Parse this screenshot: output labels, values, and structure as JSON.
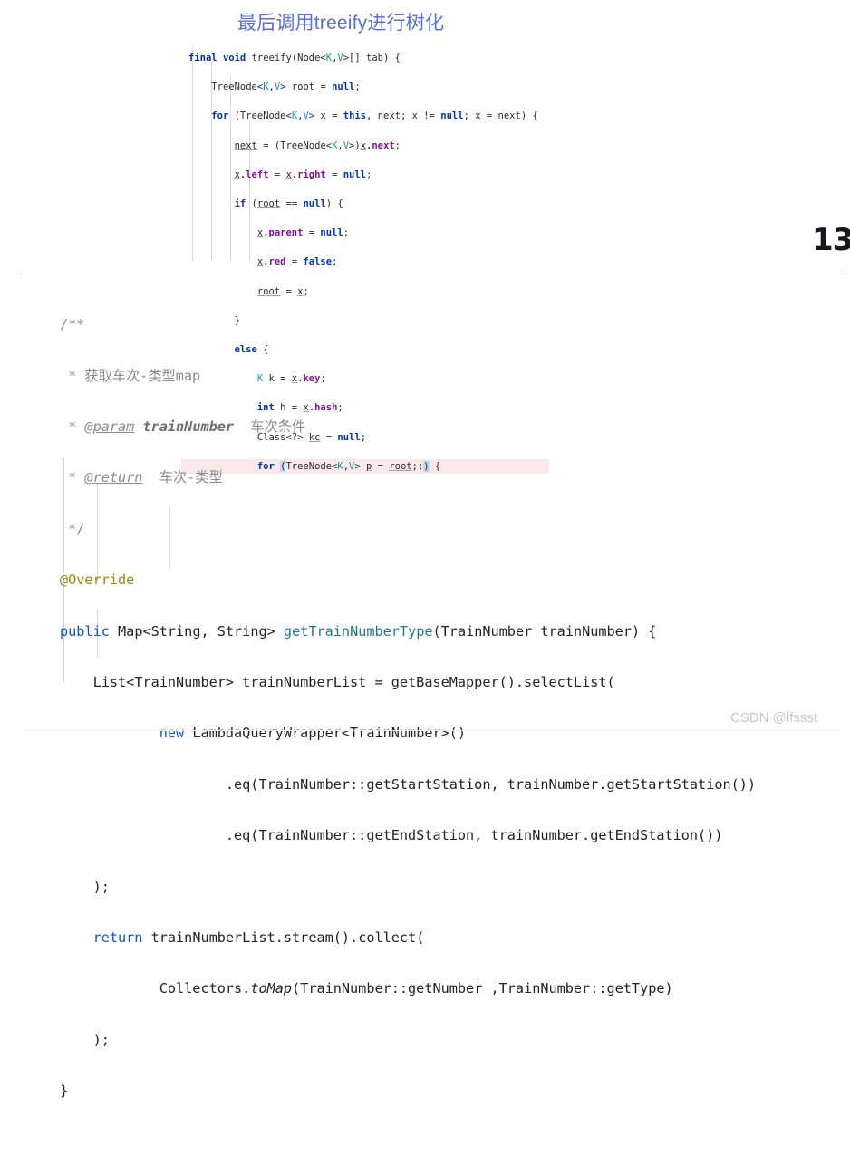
{
  "top": {
    "title": "最后调用treeify进行树化",
    "code_lines": [
      "final void treeify(Node<K,V>[] tab) {",
      "    TreeNode<K,V> root = null;",
      "    for (TreeNode<K,V> x = this, next; x != null; x = next) {",
      "        next = (TreeNode<K,V>)x.next;",
      "        x.left = x.right = null;",
      "        if (root == null) {",
      "            x.parent = null;",
      "            x.red = false;",
      "            root = x;",
      "        }",
      "        else {",
      "            K k = x.key;",
      "            int h = x.hash;",
      "            Class<?> kc = null;",
      "            for (TreeNode<K,V> p = root;;) {"
    ],
    "highlighted_line_index": 14
  },
  "watermark": {
    "text": "13"
  },
  "bottom": {
    "code_lines": [
      "/**",
      " * 获取车次-类型map",
      " * @param trainNumber 车次条件",
      " * @return 车次-类型",
      " */",
      "@Override",
      "public Map<String, String> getTrainNumberType(TrainNumber trainNumber) {",
      "    List<TrainNumber> trainNumberList = getBaseMapper().selectList(",
      "            new LambdaQueryWrapper<TrainNumber>()",
      "                    .eq(TrainNumber::getStartStation, trainNumber.getStartStation())",
      "                    .eq(TrainNumber::getEndStation, trainNumber.getEndStation())",
      "    );",
      "    return trainNumberList.stream().collect(",
      "            Collectors.toMap(TrainNumber::getNumber ,TrainNumber::getType)",
      "    );",
      "}"
    ],
    "javadoc": {
      "open": "/**",
      "line_summary": " * 获取车次-类型map",
      "param_tag": "@param",
      "param_name": "trainNumber",
      "param_desc": "车次条件",
      "return_tag": "@return",
      "return_desc": "车次-类型",
      "close": " */"
    },
    "annotation": "@Override",
    "signature": {
      "modifier": "public",
      "return_type": "Map<String, String>",
      "method_name": "getTrainNumberType",
      "params": "(TrainNumber trainNumber) {"
    },
    "keywords": {
      "new": "new",
      "return": "return"
    }
  },
  "footer": {
    "credit": "CSDN @lfssst"
  },
  "colors": {
    "title_blue": "#5a6fd6",
    "keyword_blue": "#0f52d6",
    "method_teal": "#1a7a8c",
    "annotation_olive": "#9e880d",
    "comment_grey": "#8c8c8c",
    "highlight_pink": "#fbe9e9",
    "bracket_highlight": "#bdd6fb",
    "divider_grey": "#c9c9c9",
    "footer_grey": "#c9c9cd"
  }
}
